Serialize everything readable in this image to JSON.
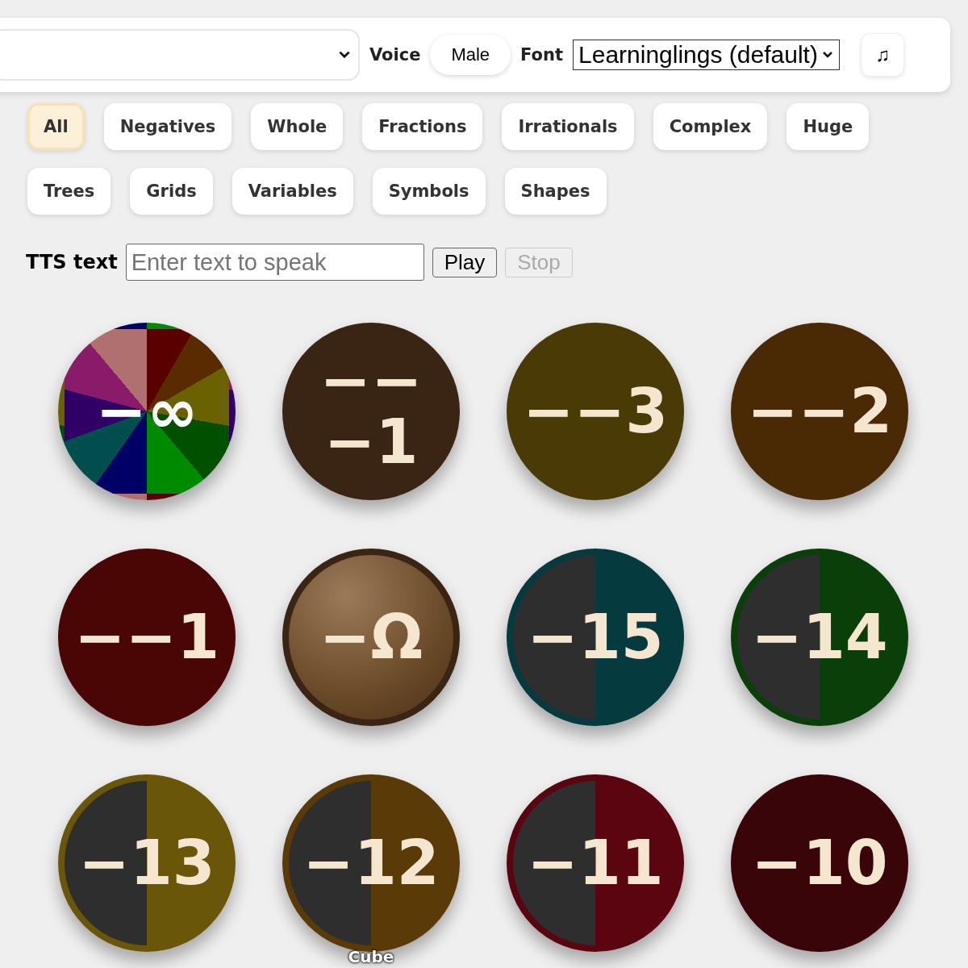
{
  "toolbar": {
    "voice_label": "Voice",
    "voice_button": "Male",
    "font_label": "Font",
    "font_select": "Learninglings (default)",
    "music_button": "♫"
  },
  "filters": [
    {
      "label": "All",
      "selected": true
    },
    {
      "label": "Negatives",
      "selected": false
    },
    {
      "label": "Whole",
      "selected": false
    },
    {
      "label": "Fractions",
      "selected": false
    },
    {
      "label": "Irrationals",
      "selected": false
    },
    {
      "label": "Complex",
      "selected": false
    },
    {
      "label": "Huge",
      "selected": false
    },
    {
      "label": "Trees",
      "selected": false
    },
    {
      "label": "Grids",
      "selected": false
    },
    {
      "label": "Variables",
      "selected": false
    },
    {
      "label": "Symbols",
      "selected": false
    },
    {
      "label": "Shapes",
      "selected": false
    }
  ],
  "tts": {
    "label": "TTS text",
    "placeholder": "Enter text to speak",
    "play": "Play",
    "stop": "Stop",
    "stop_disabled": true
  },
  "tiles": [
    {
      "kind": "pie",
      "lines": [
        "−∞"
      ]
    },
    {
      "kind": "plain",
      "color": "#3a2414",
      "lines": [
        "−−",
        "−1"
      ]
    },
    {
      "kind": "plain",
      "color": "#4a3a05",
      "lines": [
        "−−3"
      ]
    },
    {
      "kind": "plain",
      "color": "#4a2a05",
      "lines": [
        "−−2"
      ]
    },
    {
      "kind": "plain",
      "color": "#4a0505",
      "lines": [
        "−−1"
      ]
    },
    {
      "kind": "glossy",
      "color": "#6a4a28",
      "lines": [
        "−Ω"
      ]
    },
    {
      "kind": "split",
      "color": "#053a3e",
      "lines": [
        "−15"
      ]
    },
    {
      "kind": "split",
      "color": "#0a3f0a",
      "lines": [
        "−14"
      ]
    },
    {
      "kind": "split",
      "color": "#6a5608",
      "lines": [
        "−13"
      ]
    },
    {
      "kind": "split",
      "color": "#5a3a06",
      "lines": [
        "−12"
      ],
      "caption": "Cube"
    },
    {
      "kind": "split",
      "color": "#5a0510",
      "lines": [
        "−11"
      ]
    },
    {
      "kind": "plain",
      "color": "#3a0508",
      "lines": [
        "−10"
      ]
    }
  ]
}
